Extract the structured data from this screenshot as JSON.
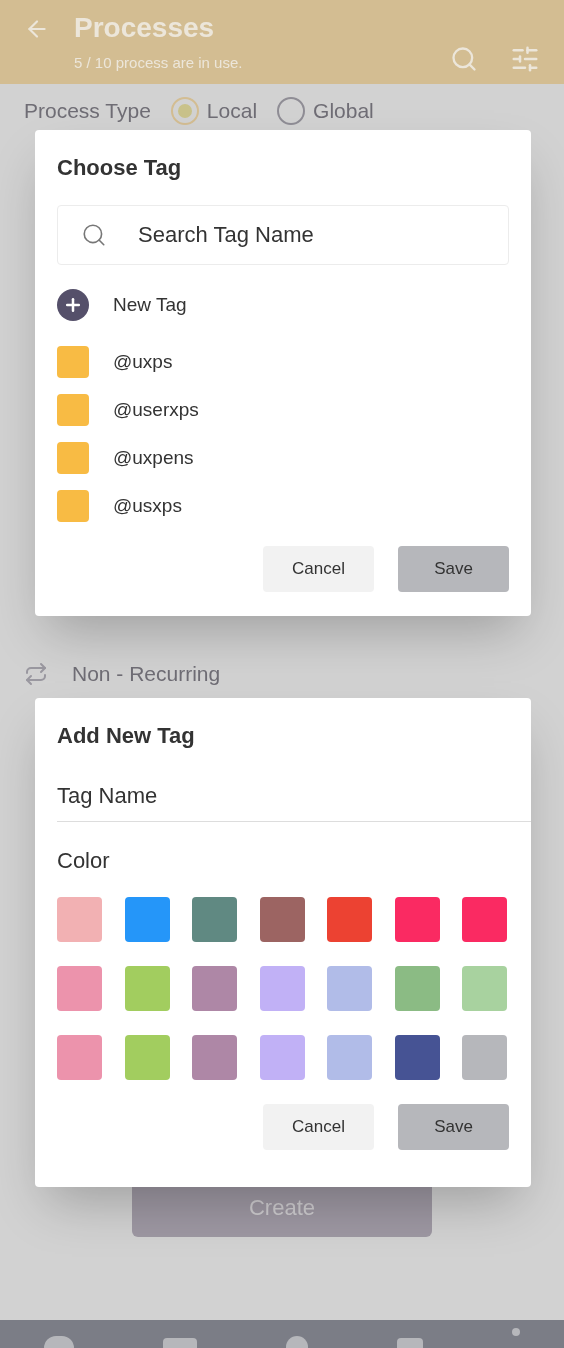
{
  "header": {
    "title": "Processes",
    "subtitle": "5 / 10 process are in use."
  },
  "background": {
    "process_type_label": "Process Type",
    "options": [
      {
        "label": "Local",
        "selected": true
      },
      {
        "label": "Global",
        "selected": false
      }
    ],
    "recurrence": "Non - Recurring",
    "create_button": "Create"
  },
  "choose_tag_dialog": {
    "title": "Choose Tag",
    "search": {
      "placeholder": "Search Tag Name"
    },
    "new_tag": "New Tag",
    "tags": [
      {
        "name": "@uxps",
        "color": "#f8bb44"
      },
      {
        "name": "@userxps",
        "color": "#f8bb44"
      },
      {
        "name": "@uxpens",
        "color": "#f8bb44"
      },
      {
        "name": "@usxps",
        "color": "#f8bb44"
      }
    ],
    "buttons": [
      "Cancel",
      "Save"
    ]
  },
  "add_tag_dialog": {
    "title": "Add New Tag",
    "name_field": {
      "placeholder": "Tag Name"
    },
    "color_label": "Color",
    "colors": [
      {
        "color": "#f2b1b3"
      },
      {
        "color": "#2596f9"
      },
      {
        "color": "#608982"
      },
      {
        "color": "#9c6462"
      },
      {
        "color": "#ec4232"
      },
      {
        "color": "#fa2a62"
      },
      {
        "color": "#fa2a62"
      },
      {
        "color": "#ec93ac"
      },
      {
        "color": "#a2cd5f"
      },
      {
        "color": "#ae87a6"
      },
      {
        "color": "#c1b1f6"
      },
      {
        "color": "#b1bce8"
      },
      {
        "color": "#8bbb84"
      },
      {
        "color": "#a8d29f"
      },
      {
        "color": "#ec93ac"
      },
      {
        "color": "#a2cd5f"
      },
      {
        "color": "#ae87a6"
      },
      {
        "color": "#c1b1f6"
      },
      {
        "color": "#b1bce8"
      },
      {
        "color": "#465394"
      },
      {
        "color": "#b6b7bb"
      }
    ],
    "buttons": [
      "Cancel",
      "Save"
    ]
  }
}
